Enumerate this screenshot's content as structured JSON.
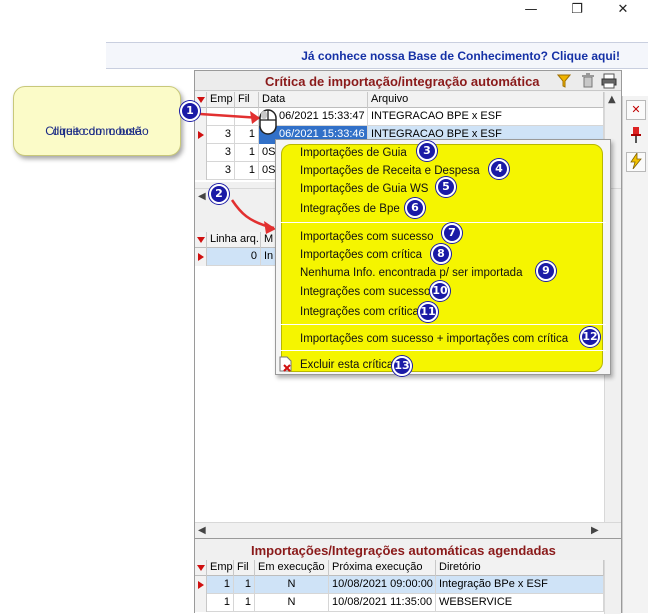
{
  "window_controls": {
    "minimize": "—",
    "maximize": "❐",
    "close": "✕"
  },
  "banner": {
    "text": "Já conhece nossa Base de Conhecimento? Clique aqui!"
  },
  "top_grid": {
    "title": "Crítica de importação/integração automática",
    "columns": [
      "Emp",
      "Fil",
      "Data",
      "Arquivo"
    ],
    "rows": [
      {
        "emp": "",
        "fil": "",
        "data": "06/2021 15:33:47",
        "arquivo": "INTEGRACAO BPE x ESF"
      },
      {
        "emp": "3",
        "fil": "1",
        "data": "06/2021 15:33:46",
        "arquivo": "INTEGRACAO BPE x ESF"
      },
      {
        "emp": "3",
        "fil": "1",
        "data": "0S",
        "arquivo": ""
      },
      {
        "emp": "3",
        "fil": "1",
        "data": "0S",
        "arquivo": ""
      }
    ]
  },
  "detail_grid": {
    "columns": [
      "Linha arq.",
      "M"
    ],
    "rows": [
      {
        "linha": "0",
        "m": "In"
      }
    ]
  },
  "callout": {
    "line1": "Clique com o botão",
    "line2": "direito do mouse"
  },
  "badges": [
    "1",
    "2",
    "3",
    "4",
    "5",
    "6",
    "7",
    "8",
    "9",
    "10",
    "11",
    "12",
    "13"
  ],
  "context_menu": {
    "items": [
      "Importações de Guia",
      "Importações de Receita e Despesa",
      "Importações de Guia WS",
      "Integrações de Bpe",
      "Importações com sucesso",
      "Importações com crítica",
      "Nenhuma Info. encontrada p/ ser importada",
      "Integrações com sucesso",
      "Integrações com crítica",
      "Importações com sucesso + importações com crítica",
      "Excluir esta crítica"
    ]
  },
  "bottom_grid": {
    "title": "Importações/Integrações automáticas agendadas",
    "columns": [
      "Emp",
      "Fil",
      "Em execução",
      "Próxima execução",
      "Diretório"
    ],
    "rows": [
      {
        "emp": "1",
        "fil": "1",
        "exec": "N",
        "prox": "10/08/2021 09:00:00",
        "dir": "Integração BPe x ESF"
      },
      {
        "emp": "1",
        "fil": "1",
        "exec": "N",
        "prox": "10/08/2021 11:35:00",
        "dir": "WEBSERVICE"
      }
    ]
  },
  "colors": {
    "title_red": "#8a1a1a",
    "menu_yellow": "#f5f500",
    "badge_blue": "#1a1aa6",
    "banner_blue": "#1531a6"
  }
}
